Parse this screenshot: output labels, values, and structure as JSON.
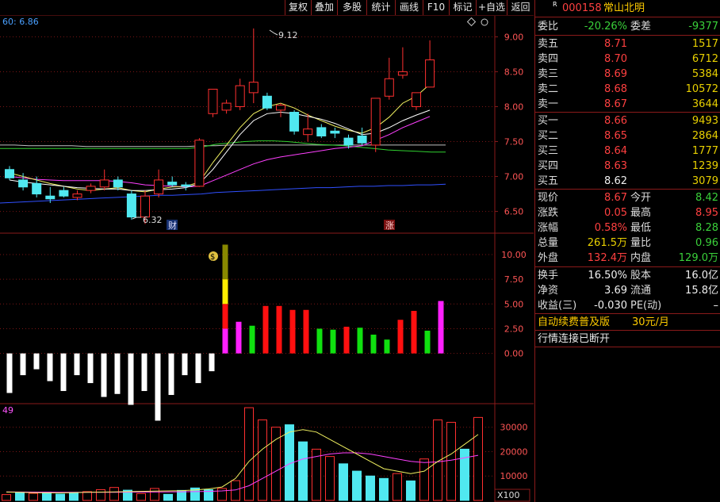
{
  "header": {
    "ma_label": "60: 6.86",
    "stock_marker": "R",
    "stock_code": "000158",
    "stock_name": "常山北明"
  },
  "toolbar": {
    "buttons": [
      "复权",
      "叠加",
      "多股",
      "统计",
      "画线",
      "F10",
      "标记",
      "+自选",
      "返回"
    ]
  },
  "price_panel": {
    "y_ticks": [
      "9.00",
      "8.50",
      "8.00",
      "7.50",
      "7.00",
      "6.50"
    ],
    "annot_high": "9.12",
    "annot_low": "6.32",
    "marker_cai": "财",
    "marker_zhang": "涨"
  },
  "indicator_panel": {
    "y_ticks": [
      "10.00",
      "7.50",
      "5.00",
      "2.50",
      "0.00"
    ],
    "badge": "$"
  },
  "volume_panel": {
    "label": "49",
    "y_ticks": [
      "30000",
      "20000",
      "10000"
    ],
    "unit": "X100"
  },
  "quote": {
    "weibi_label": "委比",
    "weibi": "-20.26%",
    "weicha_label": "委差",
    "weicha": "-9377",
    "asks": [
      {
        "label": "卖五",
        "price": "8.71",
        "vol": "1517"
      },
      {
        "label": "卖四",
        "price": "8.70",
        "vol": "6712"
      },
      {
        "label": "卖三",
        "price": "8.69",
        "vol": "5384"
      },
      {
        "label": "卖二",
        "price": "8.68",
        "vol": "10572"
      },
      {
        "label": "卖一",
        "price": "8.67",
        "vol": "3644"
      }
    ],
    "bids": [
      {
        "label": "买一",
        "price": "8.66",
        "vol": "9493"
      },
      {
        "label": "买二",
        "price": "8.65",
        "vol": "2864"
      },
      {
        "label": "买三",
        "price": "8.64",
        "vol": "1777"
      },
      {
        "label": "买四",
        "price": "8.63",
        "vol": "1239"
      },
      {
        "label": "买五",
        "price": "8.62",
        "vol": "3079"
      }
    ],
    "stats": [
      {
        "l1": "现价",
        "v1": "8.67",
        "c1": "red",
        "l2": "今开",
        "v2": "8.42",
        "c2": "green"
      },
      {
        "l1": "涨跌",
        "v1": "0.05",
        "c1": "red",
        "l2": "最高",
        "v2": "8.95",
        "c2": "red"
      },
      {
        "l1": "涨幅",
        "v1": "0.58%",
        "c1": "red",
        "l2": "最低",
        "v2": "8.28",
        "c2": "green"
      },
      {
        "l1": "总量",
        "v1": "261.5万",
        "c1": "yellow",
        "l2": "量比",
        "v2": "0.96",
        "c2": "green"
      },
      {
        "l1": "外盘",
        "v1": "132.4万",
        "c1": "red",
        "l2": "内盘",
        "v2": "129.0万",
        "c2": "green"
      },
      {
        "l1": "换手",
        "v1": "16.50%",
        "c1": "white",
        "l2": "股本",
        "v2": "16.0亿",
        "c2": "white"
      },
      {
        "l1": "净资",
        "v1": "3.69",
        "c1": "white",
        "l2": "流通",
        "v2": "15.8亿",
        "c2": "white"
      },
      {
        "l1": "收益(三)",
        "v1": "-0.030",
        "c1": "white",
        "l2": "PE(动)",
        "v2": "–",
        "c2": "white"
      }
    ],
    "promo_text": "自动续费普及版",
    "promo_price": "30元/月",
    "conn_status": "行情连接已断开"
  },
  "chart_data": {
    "type": "candlestick",
    "price_ylim": [
      6.2,
      9.3
    ],
    "candles": [
      {
        "o": 7.1,
        "h": 7.15,
        "l": 6.95,
        "c": 6.98
      },
      {
        "o": 6.95,
        "h": 7.05,
        "l": 6.8,
        "c": 6.85
      },
      {
        "o": 6.9,
        "h": 7.0,
        "l": 6.7,
        "c": 6.75
      },
      {
        "o": 6.72,
        "h": 6.85,
        "l": 6.62,
        "c": 6.68
      },
      {
        "o": 6.8,
        "h": 6.85,
        "l": 6.7,
        "c": 6.72
      },
      {
        "o": 6.7,
        "h": 6.8,
        "l": 6.66,
        "c": 6.75
      },
      {
        "o": 6.8,
        "h": 6.9,
        "l": 6.76,
        "c": 6.86
      },
      {
        "o": 6.85,
        "h": 7.1,
        "l": 6.8,
        "c": 6.95
      },
      {
        "o": 6.95,
        "h": 7.0,
        "l": 6.8,
        "c": 6.85
      },
      {
        "o": 6.75,
        "h": 6.8,
        "l": 6.38,
        "c": 6.42
      },
      {
        "o": 6.42,
        "h": 6.8,
        "l": 6.32,
        "c": 6.72
      },
      {
        "o": 6.75,
        "h": 7.1,
        "l": 6.7,
        "c": 6.95
      },
      {
        "o": 6.92,
        "h": 7.0,
        "l": 6.85,
        "c": 6.88
      },
      {
        "o": 6.88,
        "h": 6.92,
        "l": 6.8,
        "c": 6.86
      },
      {
        "o": 6.86,
        "h": 7.55,
        "l": 6.85,
        "c": 7.52
      },
      {
        "o": 7.9,
        "h": 8.25,
        "l": 7.85,
        "c": 8.25
      },
      {
        "o": 7.95,
        "h": 8.1,
        "l": 7.9,
        "c": 8.05
      },
      {
        "o": 8.0,
        "h": 8.4,
        "l": 7.95,
        "c": 8.3
      },
      {
        "o": 8.2,
        "h": 9.12,
        "l": 8.05,
        "c": 8.35
      },
      {
        "o": 8.15,
        "h": 8.2,
        "l": 7.95,
        "c": 7.98
      },
      {
        "o": 7.95,
        "h": 8.05,
        "l": 7.85,
        "c": 8.02
      },
      {
        "o": 7.92,
        "h": 7.95,
        "l": 7.6,
        "c": 7.65
      },
      {
        "o": 7.6,
        "h": 7.9,
        "l": 7.5,
        "c": 7.68
      },
      {
        "o": 7.7,
        "h": 7.75,
        "l": 7.55,
        "c": 7.58
      },
      {
        "o": 7.65,
        "h": 7.7,
        "l": 7.55,
        "c": 7.62
      },
      {
        "o": 7.55,
        "h": 7.6,
        "l": 7.4,
        "c": 7.45
      },
      {
        "o": 7.58,
        "h": 7.7,
        "l": 7.45,
        "c": 7.48
      },
      {
        "o": 7.45,
        "h": 8.1,
        "l": 7.35,
        "c": 8.12
      },
      {
        "o": 8.15,
        "h": 8.7,
        "l": 8.1,
        "c": 8.4
      },
      {
        "o": 8.45,
        "h": 8.85,
        "l": 8.4,
        "c": 8.5
      },
      {
        "o": 8.0,
        "h": 8.2,
        "l": 7.95,
        "c": 8.2
      },
      {
        "o": 8.28,
        "h": 8.95,
        "l": 8.28,
        "c": 8.67
      }
    ],
    "ma_yellow": [
      7.05,
      7.0,
      6.95,
      6.9,
      6.86,
      6.82,
      6.8,
      6.82,
      6.84,
      6.8,
      6.78,
      6.82,
      6.85,
      6.86,
      6.92,
      7.2,
      7.45,
      7.7,
      7.9,
      8.0,
      8.05,
      7.98,
      7.88,
      7.8,
      7.72,
      7.66,
      7.62,
      7.7,
      7.85,
      8.05,
      8.15,
      8.32
    ],
    "ma_white": [
      6.95,
      6.92,
      6.9,
      6.88,
      6.86,
      6.84,
      6.83,
      6.82,
      6.82,
      6.8,
      6.8,
      6.81,
      6.82,
      6.84,
      6.9,
      7.1,
      7.35,
      7.6,
      7.8,
      7.9,
      7.92,
      7.9,
      7.86,
      7.82,
      7.76,
      7.68,
      7.6,
      7.62,
      7.7,
      7.8,
      7.88,
      7.95
    ],
    "ma_magenta": [
      7.0,
      6.98,
      6.96,
      6.95,
      6.94,
      6.94,
      6.94,
      6.94,
      6.93,
      6.91,
      6.88,
      6.87,
      6.86,
      6.85,
      6.86,
      6.94,
      7.02,
      7.1,
      7.18,
      7.24,
      7.28,
      7.31,
      7.34,
      7.37,
      7.4,
      7.42,
      7.44,
      7.52,
      7.6,
      7.7,
      7.78,
      7.86
    ],
    "ma_green": [
      7.4,
      7.4,
      7.4,
      7.4,
      7.4,
      7.4,
      7.4,
      7.4,
      7.4,
      7.4,
      7.4,
      7.4,
      7.4,
      7.4,
      7.42,
      7.46,
      7.48,
      7.5,
      7.51,
      7.51,
      7.5,
      7.48,
      7.46,
      7.45,
      7.44,
      7.42,
      7.4,
      7.38,
      7.37,
      7.36,
      7.35,
      7.35
    ],
    "ma_blue": [
      6.62,
      6.63,
      6.64,
      6.65,
      6.66,
      6.67,
      6.68,
      6.69,
      6.7,
      6.71,
      6.72,
      6.73,
      6.73,
      6.74,
      6.75,
      6.77,
      6.78,
      6.79,
      6.8,
      6.81,
      6.82,
      6.83,
      6.84,
      6.84,
      6.85,
      6.86,
      6.86,
      6.87,
      6.87,
      6.88,
      6.88,
      6.89
    ],
    "ma_gray": [
      7.45,
      7.45,
      7.44,
      7.44,
      7.44,
      7.44,
      7.43,
      7.43,
      7.43,
      7.43,
      7.43,
      7.43,
      7.43,
      7.43,
      7.44,
      7.44,
      7.45,
      7.45,
      7.45,
      7.45,
      7.45,
      7.45,
      7.45,
      7.45,
      7.45,
      7.45,
      7.45,
      7.45,
      7.45,
      7.45,
      7.45,
      7.45
    ],
    "indicator_ylim": [
      -5.0,
      12.0
    ],
    "indicator_values": [
      -4.0,
      -2.2,
      -1.6,
      -2.8,
      -3.8,
      -2.2,
      -3.0,
      -4.4,
      -4.1,
      -5.2,
      -3.8,
      -6.8,
      -4.2,
      -2.2,
      -3.0,
      -1.8,
      11.0,
      3.2,
      2.8,
      4.8,
      4.8,
      4.4,
      4.4,
      2.5,
      2.4,
      2.7,
      2.6,
      1.9,
      1.4,
      3.4,
      4.3,
      2.3,
      5.3
    ],
    "indicator_colors": [
      "white",
      "white",
      "white",
      "white",
      "white",
      "white",
      "white",
      "white",
      "white",
      "white",
      "white",
      "white",
      "white",
      "white",
      "white",
      "white",
      "stack",
      "magenta",
      "green",
      "red",
      "red",
      "red",
      "red",
      "green",
      "green",
      "red",
      "green",
      "green",
      "green",
      "red",
      "red",
      "green",
      "magenta"
    ],
    "volume_ylim": [
      0,
      39000
    ],
    "volume_values": [
      2400,
      3100,
      2900,
      3400,
      2600,
      3300,
      3600,
      4400,
      5300,
      4200,
      2800,
      4900,
      2500,
      4100,
      5100,
      4400,
      4900,
      8100,
      38000,
      33000,
      30000,
      31000,
      24000,
      21000,
      18000,
      15000,
      12000,
      10000,
      9000,
      11000,
      8000,
      17000,
      33000,
      32000,
      21000,
      34000
    ],
    "volume_up": [
      true,
      false,
      true,
      false,
      false,
      false,
      true,
      true,
      true,
      false,
      true,
      true,
      false,
      false,
      false,
      false,
      true,
      true,
      true,
      true,
      true,
      false,
      false,
      true,
      true,
      false,
      false,
      false,
      false,
      true,
      false,
      true,
      true,
      true,
      false,
      true
    ],
    "vol_ma_yellow": [
      3400,
      3300,
      3200,
      3100,
      3100,
      3200,
      3300,
      3400,
      3500,
      3600,
      3700,
      3800,
      3900,
      4000,
      4300,
      4700,
      5500,
      9000,
      16000,
      21000,
      25000,
      28000,
      29000,
      28000,
      25000,
      22000,
      19000,
      16000,
      13000,
      12000,
      11000,
      12000,
      16000,
      19000,
      23000,
      27000
    ],
    "vol_ma_magenta": [
      3500,
      3450,
      3400,
      3380,
      3360,
      3350,
      3340,
      3340,
      3350,
      3380,
      3400,
      3450,
      3500,
      3550,
      3600,
      3700,
      3900,
      4300,
      6000,
      9000,
      12000,
      15000,
      17000,
      18000,
      19000,
      19500,
      19500,
      19000,
      18000,
      17000,
      16000,
      15500,
      15800,
      16500,
      17500,
      18500
    ]
  }
}
